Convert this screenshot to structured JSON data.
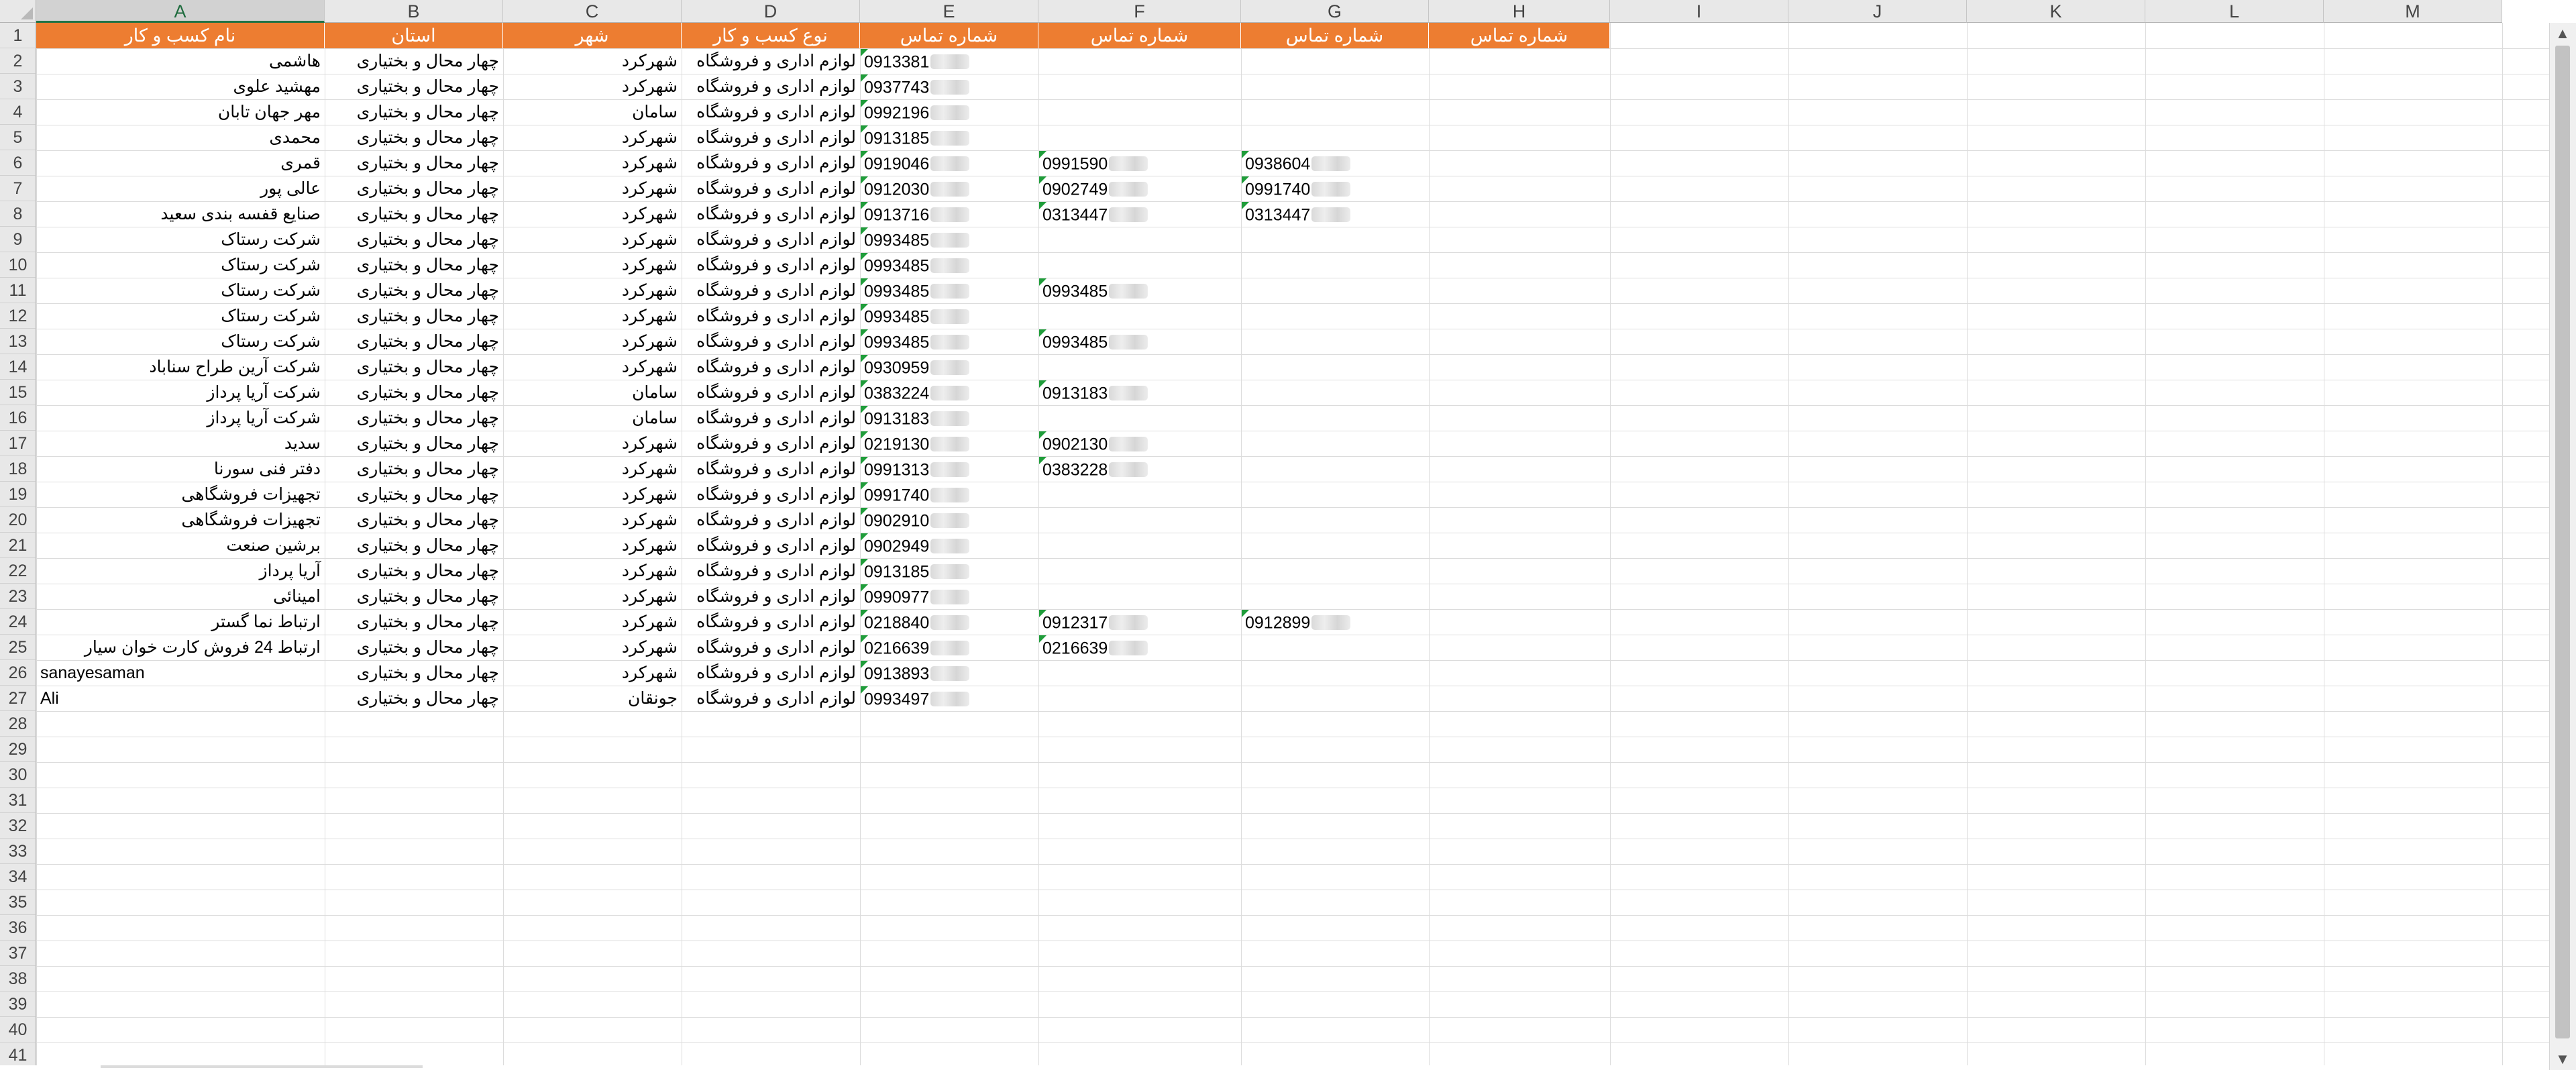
{
  "columns": [
    "A",
    "B",
    "C",
    "D",
    "E",
    "F",
    "G",
    "H",
    "I",
    "J",
    "K",
    "L",
    "M"
  ],
  "selected_column": "A",
  "row_numbers": [
    "1",
    "2",
    "3",
    "4",
    "5",
    "6",
    "7",
    "8",
    "9",
    "10",
    "11",
    "12",
    "13",
    "14",
    "15",
    "16",
    "17",
    "18",
    "19",
    "20",
    "21",
    "22",
    "23",
    "24",
    "25",
    "26",
    "27",
    "28",
    "29",
    "30",
    "31",
    "32",
    "33",
    "34",
    "35",
    "36",
    "37",
    "38",
    "39",
    "40",
    "41"
  ],
  "header_row": [
    "نام کسب و کار",
    "استان",
    "شهر",
    "نوع کسب و کار",
    "شماره تماس",
    "شماره تماس",
    "شماره تماس",
    "شماره تماس"
  ],
  "colors": {
    "header_fill": "#ed7d31",
    "header_text": "#ffffff",
    "comment_indicator": "#1f9d3a",
    "selected_column_accent": "#217346"
  },
  "rows": [
    {
      "name": "هاشمی",
      "province": "چهار محال و بختیاری",
      "city": "شهرکرد",
      "type": "لوازم اداری و فروشگاه",
      "phones": [
        "0913381",
        "",
        ""
      ]
    },
    {
      "name": "مهشید علوی",
      "province": "چهار محال و بختیاری",
      "city": "شهرکرد",
      "type": "لوازم اداری و فروشگاه",
      "phones": [
        "0937743",
        "",
        ""
      ]
    },
    {
      "name": "مهر جهان تابان",
      "province": "چهار محال و بختیاری",
      "city": "سامان",
      "type": "لوازم اداری و فروشگاه",
      "phones": [
        "0992196",
        "",
        ""
      ]
    },
    {
      "name": "محمدی",
      "province": "چهار محال و بختیاری",
      "city": "شهرکرد",
      "type": "لوازم اداری و فروشگاه",
      "phones": [
        "0913185",
        "",
        ""
      ]
    },
    {
      "name": "قمری",
      "province": "چهار محال و بختیاری",
      "city": "شهرکرد",
      "type": "لوازم اداری و فروشگاه",
      "phones": [
        "0919046",
        "0991590",
        "0938604"
      ]
    },
    {
      "name": "عالی پور",
      "province": "چهار محال و بختیاری",
      "city": "شهرکرد",
      "type": "لوازم اداری و فروشگاه",
      "phones": [
        "0912030",
        "0902749",
        "0991740"
      ]
    },
    {
      "name": "صنایع قفسه بندی سعید",
      "province": "چهار محال و بختیاری",
      "city": "شهرکرد",
      "type": "لوازم اداری و فروشگاه",
      "phones": [
        "0913716",
        "0313447",
        "0313447"
      ]
    },
    {
      "name": "شرکت رستاک",
      "province": "چهار محال و بختیاری",
      "city": "شهرکرد",
      "type": "لوازم اداری و فروشگاه",
      "phones": [
        "0993485",
        "",
        ""
      ]
    },
    {
      "name": "شرکت رستاک",
      "province": "چهار محال و بختیاری",
      "city": "شهرکرد",
      "type": "لوازم اداری و فروشگاه",
      "phones": [
        "0993485",
        "",
        ""
      ]
    },
    {
      "name": "شرکت رستاک",
      "province": "چهار محال و بختیاری",
      "city": "شهرکرد",
      "type": "لوازم اداری و فروشگاه",
      "phones": [
        "0993485",
        "0993485",
        ""
      ]
    },
    {
      "name": "شرکت رستاک",
      "province": "چهار محال و بختیاری",
      "city": "شهرکرد",
      "type": "لوازم اداری و فروشگاه",
      "phones": [
        "0993485",
        "",
        ""
      ]
    },
    {
      "name": "شرکت رستاک",
      "province": "چهار محال و بختیاری",
      "city": "شهرکرد",
      "type": "لوازم اداری و فروشگاه",
      "phones": [
        "0993485",
        "0993485",
        ""
      ]
    },
    {
      "name": "شرکت آرین طراح سناباد",
      "province": "چهار محال و بختیاری",
      "city": "شهرکرد",
      "type": "لوازم اداری و فروشگاه",
      "phones": [
        "0930959",
        "",
        ""
      ]
    },
    {
      "name": "شرکت آریا پرداز",
      "province": "چهار محال و بختیاری",
      "city": "سامان",
      "type": "لوازم اداری و فروشگاه",
      "phones": [
        "0383224",
        "0913183",
        ""
      ]
    },
    {
      "name": "شرکت آریا پرداز",
      "province": "چهار محال و بختیاری",
      "city": "سامان",
      "type": "لوازم اداری و فروشگاه",
      "phones": [
        "0913183",
        "",
        ""
      ]
    },
    {
      "name": "سدید",
      "province": "چهار محال و بختیاری",
      "city": "شهرکرد",
      "type": "لوازم اداری و فروشگاه",
      "phones": [
        "0219130",
        "0902130",
        ""
      ]
    },
    {
      "name": "دفتر فنی سورنا",
      "province": "چهار محال و بختیاری",
      "city": "شهرکرد",
      "type": "لوازم اداری و فروشگاه",
      "phones": [
        "0991313",
        "0383228",
        ""
      ]
    },
    {
      "name": "تجهیزات فروشگاهی",
      "province": "چهار محال و بختیاری",
      "city": "شهرکرد",
      "type": "لوازم اداری و فروشگاه",
      "phones": [
        "0991740",
        "",
        ""
      ]
    },
    {
      "name": "تجهیزات فروشگاهی",
      "province": "چهار محال و بختیاری",
      "city": "شهرکرد",
      "type": "لوازم اداری و فروشگاه",
      "phones": [
        "0902910",
        "",
        ""
      ]
    },
    {
      "name": "برشین صنعت",
      "province": "چهار محال و بختیاری",
      "city": "شهرکرد",
      "type": "لوازم اداری و فروشگاه",
      "phones": [
        "0902949",
        "",
        ""
      ]
    },
    {
      "name": "آریا پرداز",
      "province": "چهار محال و بختیاری",
      "city": "شهرکرد",
      "type": "لوازم اداری و فروشگاه",
      "phones": [
        "0913185",
        "",
        ""
      ]
    },
    {
      "name": "امینائی",
      "province": "چهار محال و بختیاری",
      "city": "شهرکرد",
      "type": "لوازم اداری و فروشگاه",
      "phones": [
        "0990977",
        "",
        ""
      ]
    },
    {
      "name": "ارتباط نما گستر",
      "province": "چهار محال و بختیاری",
      "city": "شهرکرد",
      "type": "لوازم اداری و فروشگاه",
      "phones": [
        "0218840",
        "0912317",
        "0912899"
      ]
    },
    {
      "name": "ارتباط 24 فروش کارت خوان سیار",
      "province": "چهار محال و بختیاری",
      "city": "شهرکرد",
      "type": "لوازم اداری و فروشگاه",
      "phones": [
        "0216639",
        "0216639",
        ""
      ]
    },
    {
      "name": "sanayesaman",
      "province": "چهار محال و بختیاری",
      "city": "شهرکرد",
      "type": "لوازم اداری و فروشگاه",
      "phones": [
        "0913893",
        "",
        ""
      ]
    },
    {
      "name": "Ali",
      "province": "چهار محال و بختیاری",
      "city": "جونقان",
      "type": "لوازم اداری و فروشگاه",
      "phones": [
        "0993497",
        "",
        ""
      ]
    }
  ]
}
